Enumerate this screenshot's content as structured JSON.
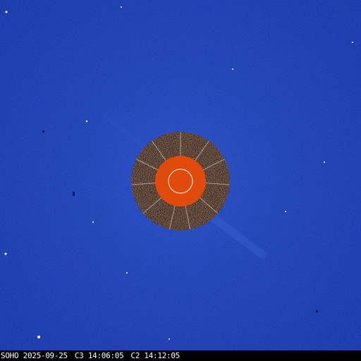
{
  "caption": {
    "observatory": "SOHO",
    "date": "2025-09-25",
    "c3_time": "C3 14:06:05",
    "c2_time": "C2 14:12:05"
  },
  "colors": {
    "background_blue": "#1d3eb0",
    "occulter_orange": "#e04a0a",
    "sun_circle": "#ffffff",
    "caption_text": "#ffffff",
    "caption_bar": "#000000"
  }
}
